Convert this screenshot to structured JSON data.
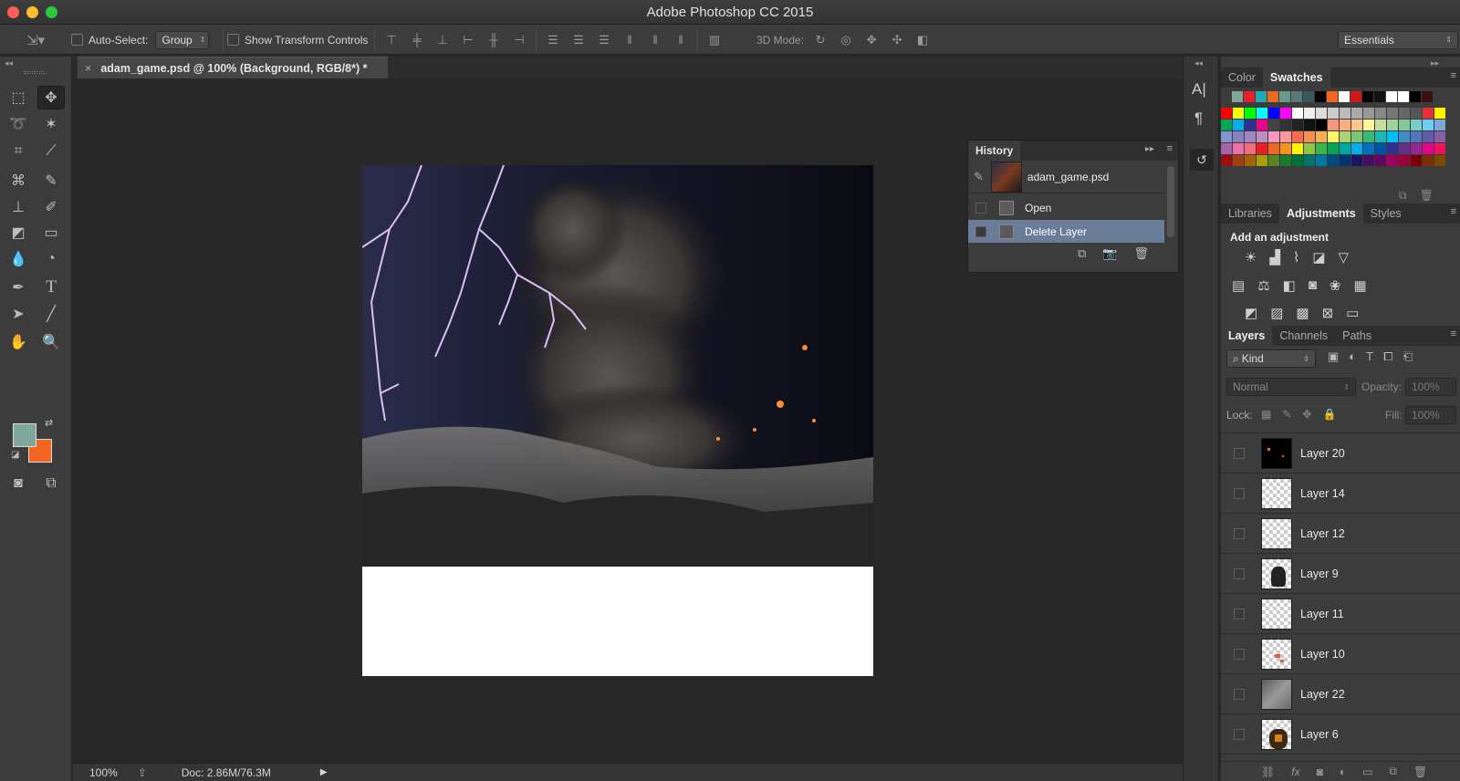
{
  "window": {
    "title": "Adobe Photoshop CC 2015",
    "traffic_lights": [
      "#ff5f57",
      "#febc2e",
      "#28c840"
    ]
  },
  "options_bar": {
    "auto_select_label": "Auto-Select:",
    "auto_select_value": "Group",
    "show_transform_label": "Show Transform Controls",
    "mode_3d_label": "3D Mode:",
    "workspace": "Essentials"
  },
  "document": {
    "tab_label": "adam_game.psd @ 100% (Background, RGB/8*) *",
    "close_glyph": "×"
  },
  "status": {
    "zoom": "100%",
    "doc_info": "Doc: 2.86M/76.3M"
  },
  "history": {
    "title": "History",
    "snapshot": "adam_game.psd",
    "items": [
      {
        "label": "Open",
        "selected": false
      },
      {
        "label": "Delete Layer",
        "selected": true
      }
    ]
  },
  "panels": {
    "color_tabs": [
      "Color",
      "Swatches"
    ],
    "active_color_tab": "Swatches",
    "adj_tabs": [
      "Libraries",
      "Adjustments",
      "Styles"
    ],
    "active_adj_tab": "Adjustments",
    "adj_heading": "Add an adjustment",
    "layer_tabs": [
      "Layers",
      "Channels",
      "Paths"
    ],
    "active_layer_tab": "Layers",
    "kind_filter": "Kind",
    "blend_mode": "Normal",
    "opacity_label": "Opacity:",
    "opacity_value": "100%",
    "lock_label": "Lock:",
    "fill_label": "Fill:",
    "fill_value": "100%"
  },
  "layers": [
    {
      "name": "Layer 20",
      "thumb": "dark"
    },
    {
      "name": "Layer 14",
      "thumb": "transparent"
    },
    {
      "name": "Layer 12",
      "thumb": "transparent"
    },
    {
      "name": "Layer 9",
      "thumb": "figure"
    },
    {
      "name": "Layer 11",
      "thumb": "transparent"
    },
    {
      "name": "Layer 10",
      "thumb": "orange"
    },
    {
      "name": "Layer 22",
      "thumb": "gray"
    },
    {
      "name": "Layer 6",
      "thumb": "figure2"
    }
  ],
  "colors": {
    "foreground": "#7fa899",
    "background": "#f26521",
    "selected_row": "#6a7d98"
  }
}
